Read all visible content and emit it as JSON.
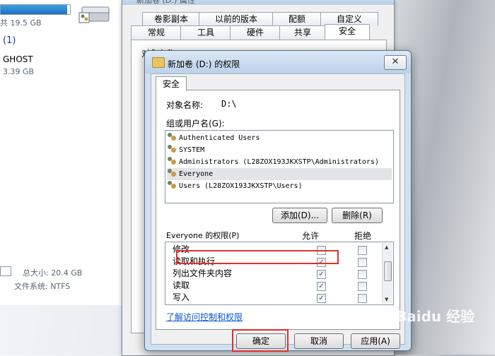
{
  "explorer": {
    "free_text": "共 19.5 GB",
    "group_count": "(1)",
    "drive_name": "GHOST",
    "drive_size": "3.39 GB",
    "total_label": "总大小: 20.4 GB",
    "fs_label": "文件系统: NTFS"
  },
  "props": {
    "title": "新加卷 (D:) 属性",
    "tabs_row1": [
      "卷影副本",
      "以前的版本",
      "配额",
      "自定义"
    ],
    "tabs_row2": [
      "常规",
      "工具",
      "硬件",
      "共享",
      "安全"
    ],
    "object_label_partial": "对象名称:    D:\\"
  },
  "perm": {
    "title": "新加卷 (D:) 的权限",
    "close": "✕",
    "tab": "安全",
    "object_label": "对象名称:",
    "object_value": "D:\\",
    "group_label": "组或用户名(G):",
    "users": [
      "Authenticated Users",
      "SYSTEM",
      "Administrators (L28ZOX193JKXSTP\\Administrators)",
      "Everyone",
      "Users (L28ZOX193JKXSTP\\Users)"
    ],
    "add_button": "添加(D)...",
    "remove_button": "删除(R)",
    "perm_header": "Everyone 的权限(P)",
    "allow_header": "允许",
    "deny_header": "拒绝",
    "permissions": [
      {
        "name": "修改",
        "allow": false,
        "deny": false
      },
      {
        "name": "读取和执行",
        "allow": true,
        "deny": false
      },
      {
        "name": "列出文件夹内容",
        "allow": true,
        "deny": false
      },
      {
        "name": "读取",
        "allow": true,
        "deny": false
      },
      {
        "name": "写入",
        "allow": true,
        "deny": false
      }
    ],
    "link": "了解访问控制和权限",
    "ok": "确定",
    "cancel": "取消",
    "apply": "应用(A)"
  },
  "watermark": "Baidu 经验"
}
